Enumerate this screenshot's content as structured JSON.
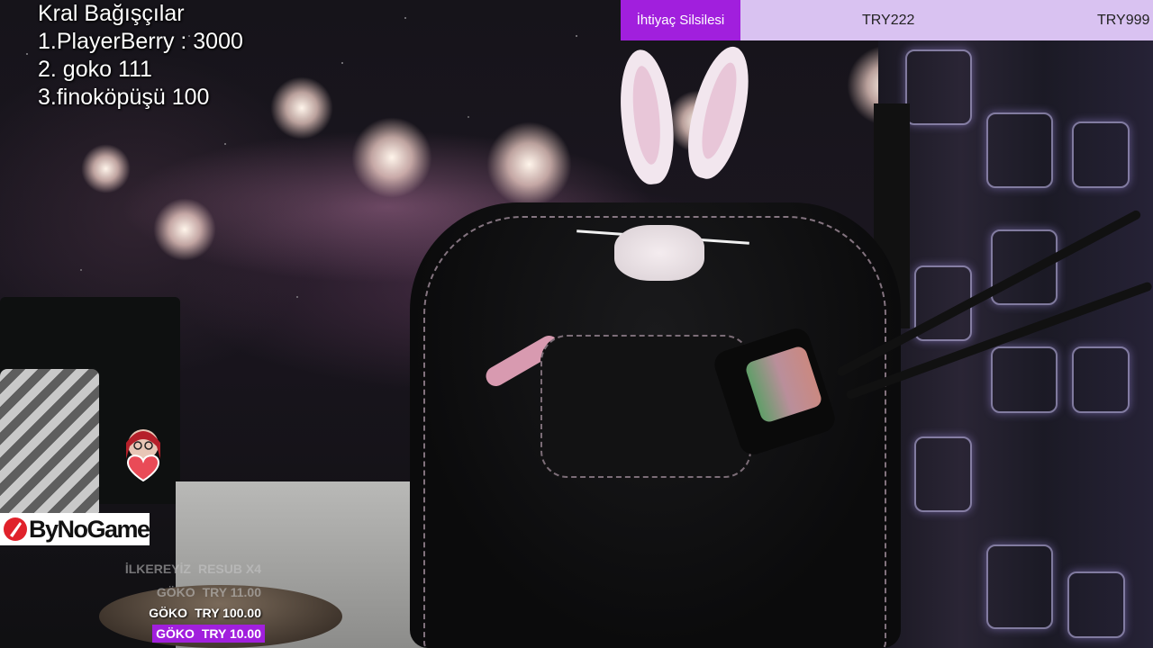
{
  "donors_overlay": {
    "title": "Kral Bağışçılar",
    "lines": [
      "1.PlayerBerry : 3000",
      "2. goko 111",
      "3.finoköpüşü 100"
    ]
  },
  "goals_bar": {
    "active_label": "İhtiyaç Silsilesi",
    "items": [
      "TRY222",
      "TRY999"
    ],
    "colors": {
      "bar": "#d9c2f1",
      "active": "#a11fdd"
    }
  },
  "brand": {
    "name": "ByNoGame",
    "icon": "bynogame-logo-icon",
    "icon_color": "#e0222b"
  },
  "sticker": {
    "icon": "heart-avatar-sticker-icon"
  },
  "feed": {
    "rows": [
      {
        "name": "İLKEREYİZ",
        "detail": "RESUB X4",
        "style": "faded"
      },
      {
        "name": "GÖKO",
        "detail": "TRY 11.00",
        "style": "faded"
      },
      {
        "name": "GÖKO",
        "detail": "TRY 100.00",
        "style": "solid"
      },
      {
        "name": "GÖKO",
        "detail": "TRY 10.00",
        "style": "highlight"
      }
    ],
    "highlight_color": "#a11fdd"
  }
}
